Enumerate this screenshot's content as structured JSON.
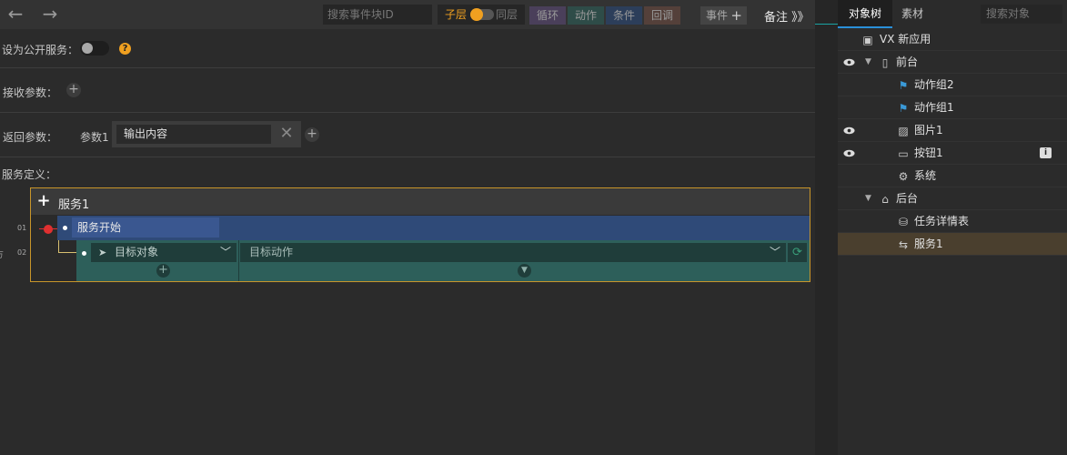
{
  "toolbar": {
    "back": "←",
    "forward": "→",
    "search_placeholder": "搜索事件块ID",
    "layer_sub": "子层",
    "layer_same": "同层",
    "filter_loop": "循环",
    "filter_action": "动作",
    "filter_condition": "条件",
    "filter_callback": "回调",
    "event_label": "事件",
    "event_plus": "+",
    "notes": "备注 》》"
  },
  "form": {
    "public_service_label": "设为公开服务：",
    "help": "?",
    "receive_params_label": "接收参数：",
    "return_params_label": "返回参数：",
    "param_name": "参数1",
    "param_value": "输出内容",
    "clear": "✕",
    "add": "+",
    "service_def_label": "服务定义："
  },
  "service": {
    "title": "服务1",
    "plus": "+",
    "start_label": "服务开始",
    "line1": "01",
    "line2": "02",
    "target_object": "目标对象",
    "target_action": "目标动作",
    "left_cut_char": "方"
  },
  "colors": {
    "accent_orange": "#f0a020",
    "service_border": "#c8952a",
    "start_row": "#2f4a78",
    "action_row": "#2d5f5a",
    "breakpoint": "#e03030",
    "tab_underline": "#2a8fd8",
    "selected_row": "#4a3f2e"
  },
  "right_panel": {
    "tab_tree": "对象树",
    "tab_assets": "素材",
    "search_placeholder": "搜索对象",
    "tree": [
      {
        "label": "VX 新应用",
        "icon": "app-icon",
        "eye": false,
        "expand": ""
      },
      {
        "label": "前台",
        "icon": "phone-icon",
        "eye": true,
        "expand": "▼"
      },
      {
        "label": "动作组2",
        "icon": "action-group-icon",
        "eye": false,
        "expand": ""
      },
      {
        "label": "动作组1",
        "icon": "action-group-icon",
        "eye": false,
        "expand": ""
      },
      {
        "label": "图片1",
        "icon": "image-icon",
        "eye": true,
        "expand": ""
      },
      {
        "label": "按钮1",
        "icon": "button-icon",
        "eye": true,
        "expand": ""
      },
      {
        "label": "系统",
        "icon": "gear-icon",
        "eye": false,
        "expand": ""
      },
      {
        "label": "后台",
        "icon": "cloud-house-icon",
        "eye": false,
        "expand": "▼"
      },
      {
        "label": "任务详情表",
        "icon": "database-icon",
        "eye": false,
        "expand": ""
      },
      {
        "label": "服务1",
        "icon": "service-icon",
        "eye": false,
        "expand": ""
      }
    ],
    "info_badge": "i"
  }
}
